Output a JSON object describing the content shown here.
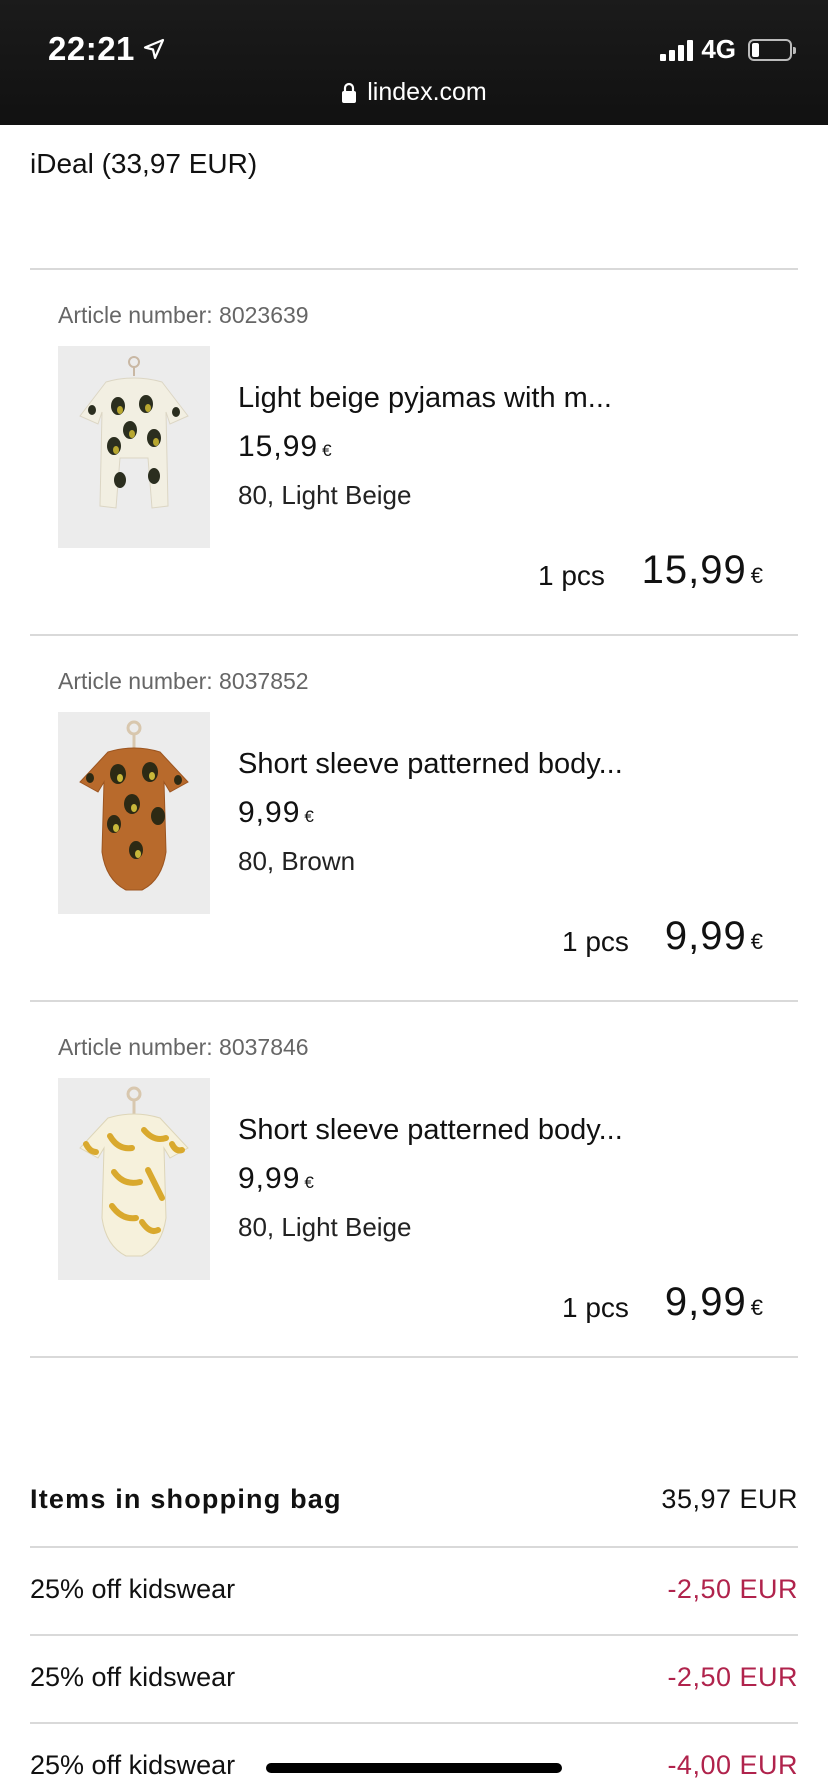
{
  "status_bar": {
    "time": "22:21",
    "network": "4G",
    "battery_level": 0.2,
    "signal_bars": 4
  },
  "browser": {
    "url": "lindex.com"
  },
  "payment": {
    "method_label": "iDeal (33,97 EUR)"
  },
  "items": [
    {
      "article_number": "Article number: 8023639",
      "name": "Light beige pyjamas with m...",
      "unit_price": "15,99",
      "variant": "80, Light Beige",
      "quantity": "1 pcs",
      "total": "15,99",
      "currency_symbol": "€",
      "image": "beige-gorilla-pyjamas-image"
    },
    {
      "article_number": "Article number: 8037852",
      "name": "Short sleeve patterned body...",
      "unit_price": "9,99",
      "variant": "80, Brown",
      "quantity": "1 pcs",
      "total": "9,99",
      "currency_symbol": "€",
      "image": "brown-gorilla-body-image"
    },
    {
      "article_number": "Article number: 8037846",
      "name": "Short sleeve patterned body...",
      "unit_price": "9,99",
      "variant": "80, Light Beige",
      "quantity": "1 pcs",
      "total": "9,99",
      "currency_symbol": "€",
      "image": "banana-print-body-image"
    }
  ],
  "summary": {
    "items_label": "Items in shopping bag",
    "items_value": "35,97 EUR",
    "discounts": [
      {
        "label": "25% off kidswear",
        "value": "-2,50 EUR"
      },
      {
        "label": "25% off kidswear",
        "value": "-2,50 EUR"
      },
      {
        "label": "25% off kidswear",
        "value": "-4,00 EUR"
      }
    ]
  },
  "colors": {
    "status_bar_bg": "#141414",
    "discount": "#b0234c",
    "divider": "#d9d9d9",
    "article_number": "#666666"
  }
}
